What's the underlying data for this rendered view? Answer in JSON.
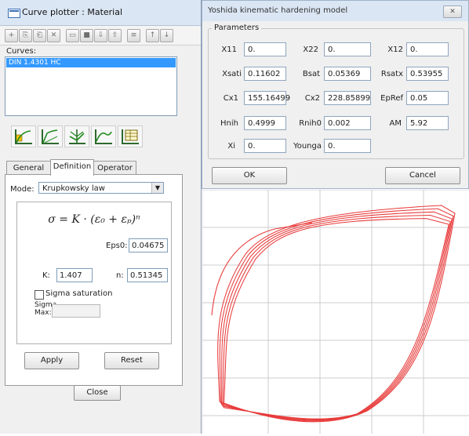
{
  "curve_plotter": {
    "title": "Curve plotter : Material",
    "curves_label": "Curves:",
    "curves": [
      "DIN 1.4301 HC"
    ],
    "tabs": [
      "General",
      "Definition",
      "Operator"
    ],
    "mode_label": "Mode:",
    "mode_value": "Krupkowsky law",
    "formula": "σ = K · (ε₀ + εₚ)ⁿ",
    "eps0_label": "Eps0:",
    "eps0_value": "0.04675",
    "k_label": "K:",
    "k_value": "1.407",
    "n_label": "n:",
    "n_value": "0.51345",
    "sigma_saturation_label": "Sigma saturation",
    "sigma_max_label_1": "Sigma",
    "sigma_max_label_2": "Max:",
    "sigma_max_value": "",
    "apply_label": "Apply",
    "reset_label": "Reset",
    "close_label": "Close"
  },
  "yoshida_dialog": {
    "title": "Yoshida kinematic hardening model",
    "close_glyph": "✕",
    "group_label": "Parameters",
    "params": [
      {
        "label": "X11",
        "value": "0."
      },
      {
        "label": "X22",
        "value": "0."
      },
      {
        "label": "X12",
        "value": "0."
      },
      {
        "label": "Xsati",
        "value": "0.11602"
      },
      {
        "label": "Bsat",
        "value": "0.05369"
      },
      {
        "label": "Rsatx",
        "value": "0.53955"
      },
      {
        "label": "Cx1",
        "value": "155.16499"
      },
      {
        "label": "Cx2",
        "value": "228.85899"
      },
      {
        "label": "EpRef",
        "value": "0.05"
      },
      {
        "label": "Hnih",
        "value": "0.4999"
      },
      {
        "label": "Rnih0",
        "value": "0.002"
      },
      {
        "label": "AM",
        "value": "5.92"
      },
      {
        "label": "Xi",
        "value": "0."
      },
      {
        "label": "Younga",
        "value": "0."
      }
    ],
    "ok_label": "OK",
    "cancel_label": "Cancel"
  },
  "plot": {
    "curve_color": "#e83a3a",
    "grid_color": "#cccccc"
  }
}
